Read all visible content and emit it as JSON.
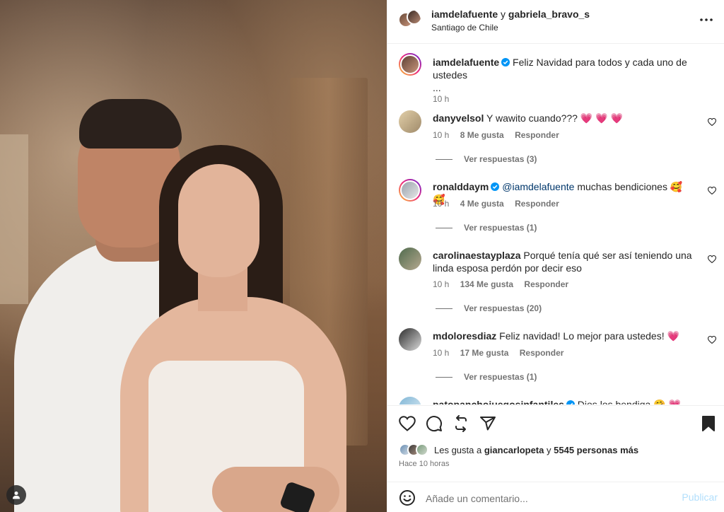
{
  "header": {
    "user1": "iamdelafuente",
    "joiner": "y",
    "user2": "gabriela_bravo_s",
    "location": "Santiago de Chile"
  },
  "caption": {
    "user": "iamdelafuente",
    "text": "Feliz Navidad para todos y cada uno de ustedes",
    "ellipsis": "...",
    "time": "10 h"
  },
  "comments": [
    {
      "user": "danyvelsol",
      "text": "Y wawito cuando???",
      "emoji": "💗 💗 💗",
      "time": "10 h",
      "likes": "8 Me gusta",
      "reply": "Responder",
      "replies": "Ver respuestas (3)"
    },
    {
      "user": "ronalddaym",
      "mention": "@iamdelafuente",
      "text": "muchas bendiciones",
      "emoji": "🥰 🥰",
      "time": "10 h",
      "likes": "4 Me gusta",
      "reply": "Responder",
      "replies": "Ver respuestas (1)"
    },
    {
      "user": "carolinaestayplaza",
      "text": "Porqué tenía qué ser así teniendo una linda esposa perdón por decir eso",
      "time": "10 h",
      "likes": "134 Me gusta",
      "reply": "Responder",
      "replies": "Ver respuestas (20)"
    },
    {
      "user": "mdoloresdiaz",
      "text": "Feliz navidad! Lo mejor para ustedes!",
      "emoji": "💗",
      "time": "10 h",
      "likes": "17 Me gusta",
      "reply": "Responder",
      "replies": "Ver respuestas (1)"
    },
    {
      "user": "patopanchojuegosinfantiles",
      "text": "Dios los bendiga",
      "emoji": "🤗 💗"
    }
  ],
  "likes": {
    "prefix": "Les gusta a",
    "user": "giancarlopeta",
    "joiner": "y",
    "count": "5545 personas más"
  },
  "time_ago": "Hace 10 horas",
  "add_comment": {
    "placeholder": "Añade un comentario...",
    "post_label": "Publicar"
  },
  "colors": {
    "accent": "#0095f6",
    "post_disabled": "#b2dffc",
    "mention": "#00376b",
    "heart": "#ed4956",
    "muted": "#737373"
  }
}
